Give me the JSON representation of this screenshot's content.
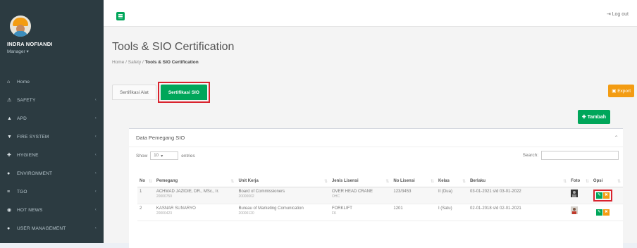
{
  "sidebar": {
    "user_name": "INDRA NOFIANDI",
    "user_role": "Manager ▾",
    "items": [
      {
        "label": "Home",
        "icon": "⌂",
        "arrow": ""
      },
      {
        "label": "SAFETY",
        "icon": "⚠",
        "arrow": "‹"
      },
      {
        "label": "APD",
        "icon": "▲",
        "arrow": "‹"
      },
      {
        "label": "FIRE SYSTEM",
        "icon": "▼",
        "arrow": "‹"
      },
      {
        "label": "HYGIENE",
        "icon": "✚",
        "arrow": "‹"
      },
      {
        "label": "ENVIRONMENT",
        "icon": "●",
        "arrow": "‹"
      },
      {
        "label": "TGO",
        "icon": "≡",
        "arrow": "‹"
      },
      {
        "label": "HOT NEWS",
        "icon": "◉",
        "arrow": "‹"
      },
      {
        "label": "USER MANAGEMENT",
        "icon": "●",
        "arrow": "‹"
      }
    ]
  },
  "topbar": {
    "logout_label": "⇥ Log out"
  },
  "page": {
    "title": "Tools & SIO Certification",
    "breadcrumb": [
      "Home",
      "Safety",
      "Tools & SIO Certification"
    ],
    "tabs": [
      {
        "label": "Sertifikasi Alat"
      },
      {
        "label": "Sertifikasi SIO"
      }
    ],
    "export_label": "▣ Export",
    "add_label": "✚ Tambah"
  },
  "box": {
    "title": "Data Pemegang SIO",
    "show_label": "Show",
    "show_value": "10",
    "entries_label": "entries",
    "search_label": "Search:"
  },
  "table": {
    "headers": [
      "No",
      "Pemegang",
      "Unit Kerja",
      "Jenis Lisensi",
      "No Lisensi",
      "Kelas",
      "Berlaku",
      "Foto",
      "Opsi"
    ],
    "rows": [
      {
        "no": "1",
        "pemegang": "ACHMAD JAZIDIE, DR., MSc., Ir.",
        "pemegang_id": "20000750",
        "unit": "Board of Commissioners",
        "unit_id": "20000002",
        "jenis": "OVER HEAD CRANE",
        "jenis_code": "OHC",
        "no_lisensi": "123/3453",
        "kelas": "II (Dua)",
        "berlaku": "03-01-2021 s/d 03-01-2022"
      },
      {
        "no": "2",
        "pemegang": "KASNAR SUNARYO",
        "pemegang_id": "20000423",
        "unit": "Bureau of Marketing Comunication",
        "unit_id": "20000120",
        "jenis": "FORKLIFT",
        "jenis_code": "FK",
        "no_lisensi": "1201",
        "kelas": "I (Satu)",
        "berlaku": "02-01-2018 s/d 02-01-2021"
      }
    ],
    "edit_icon": "✎",
    "delete_icon": "✖"
  },
  "colors": {
    "green": "#00a65a",
    "orange": "#f39c12",
    "highlight": "#d9232e",
    "sidebar": "#2c3b41"
  }
}
